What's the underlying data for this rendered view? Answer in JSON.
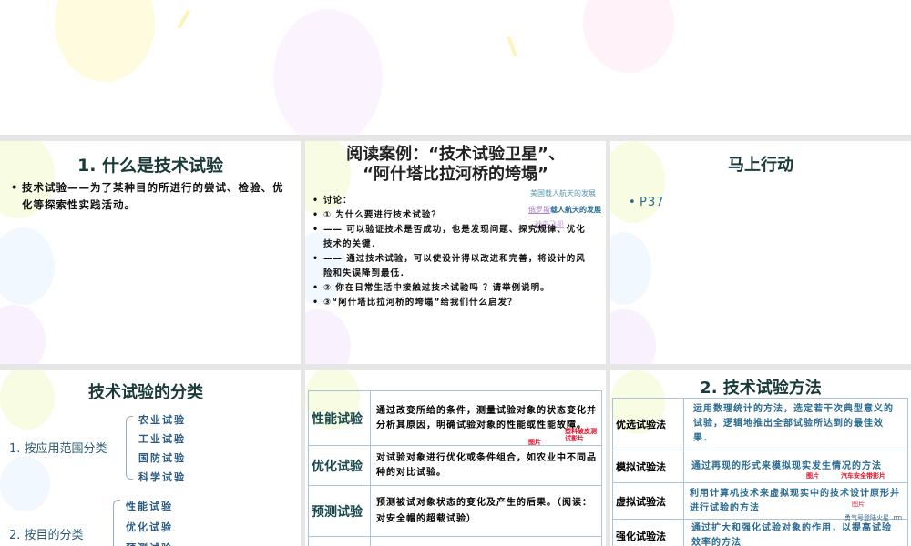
{
  "slide0": {},
  "slide1": {
    "title": "1. 什么是技术试验",
    "bullet": "技术试验——为了某种目的所进行的尝试、检验、优化等探索性实践活动。"
  },
  "slide2": {
    "title_line1": "阅读案例：“技术试验卫星”、",
    "title_line2": "“阿什塔比拉河桥的垮塌”",
    "links": [
      "美国载人航天的发展",
      "俄罗斯",
      "载人航天的发展",
      "神舟飞船"
    ],
    "bullets": [
      "讨论：",
      "① 为什么要进行技术试验？",
      "—— 可以验证技术是否成功，也是发现问题、探究规律、优化技术的关键．",
      "—— 通过技术试验，可以使设计得以改进和完善，将设计的风险和失误降到最低．",
      "② 你在日常生活中接触过技术试验吗 ？请举例说明。",
      "③“阿什塔比拉河桥的垮塌”给我们什么启发？"
    ]
  },
  "slide3": {
    "title": "马上行动",
    "bullet": "P37"
  },
  "slide4": {
    "title": "技术试验的分类",
    "group1": "1. 按应用范围分类",
    "group1_items": [
      "农业试验",
      "工业试验",
      "国防试验",
      "科学试验"
    ],
    "group2": "2. 按目的分类",
    "group2_items": [
      "性能试验",
      "优化试验",
      "预测试验"
    ]
  },
  "slide5": {
    "rows": [
      {
        "name": "性能试验",
        "desc": "通过改变所给的条件，测量试验对象的状态变化并分析其原因，明确试验对象的性能或性能故障。"
      },
      {
        "name": "优化试验",
        "desc": "对试验对象进行优化或条件组合，如农业中不同品种的对比试验。"
      },
      {
        "name": "预测试验",
        "desc": "预测被试对象状态的变化及产生的后果。（阅读：对安全帽的超载试验）"
      }
    ],
    "red1": "图片",
    "red2": "塑料破皮测试影片"
  },
  "slide6": {
    "title": "2. 技术试验方法",
    "rows": [
      {
        "name": "优选试验法",
        "desc": "运用数理统计的方法，选定若干次典型意义的试验，逻辑地推出全部试验所达到的最佳效果．"
      },
      {
        "name": "模拟试验法",
        "desc": "通过再现的形式来模拟现实发生情况的方法"
      },
      {
        "name": "虚拟试验法",
        "desc": "利用计算机技术来虚拟现实中的技术设计原形并进行试验的方法"
      },
      {
        "name": "强化试验法",
        "desc": "通过扩大和强化试验对象的作用，以提高试验效率的方法"
      }
    ],
    "red1": "图片",
    "red2": "汽车安全带影片",
    "red3": "图片",
    "link": "勇气号登陆火星 .rm"
  }
}
